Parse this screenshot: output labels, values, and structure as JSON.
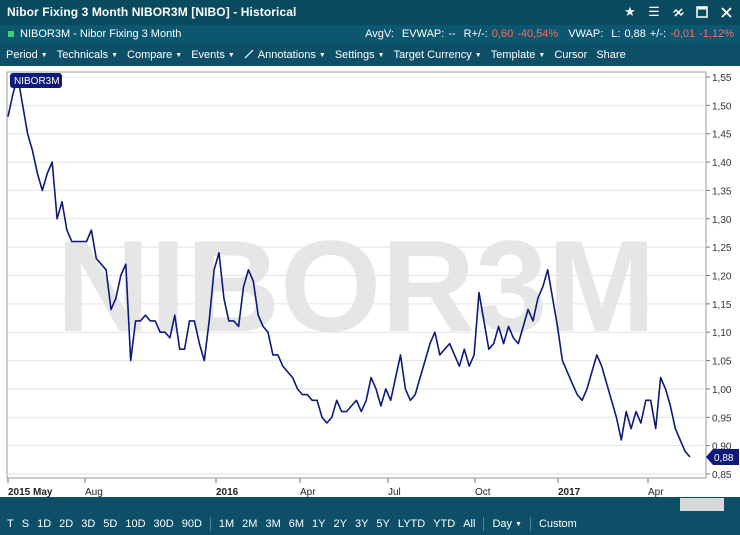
{
  "window": {
    "title": "Nibor Fixing 3 Month NIBOR3M [NIBO] - Historical",
    "icons": [
      "star-icon",
      "menu-icon",
      "unlink-icon",
      "minimize-icon",
      "close-icon"
    ]
  },
  "infobar": {
    "name": "NIBOR3M - Nibor Fixing 3 Month",
    "avgv_label": "AvgV:",
    "evwap_label": "EVWAP:",
    "evwap_value": "--",
    "change_label": "R+/-:",
    "change_value": "0,60",
    "change_pct": "-40,54%",
    "vwap_label": "VWAP:",
    "last_label": "L:",
    "last_value": "0,88",
    "day_change_label": "+/-:",
    "day_change_value": "-0,01",
    "day_change_pct": "-1,12%"
  },
  "menu": [
    {
      "label": "Period",
      "caret": true
    },
    {
      "label": "Technicals",
      "caret": true
    },
    {
      "label": "Compare",
      "caret": true
    },
    {
      "label": "Events",
      "caret": true
    },
    {
      "label": "Annotations",
      "caret": true
    },
    {
      "label": "Settings",
      "caret": true
    },
    {
      "label": "Target Currency",
      "caret": true
    },
    {
      "label": "Template",
      "caret": true
    },
    {
      "label": "Cursor",
      "caret": false
    },
    {
      "label": "Share",
      "caret": false
    }
  ],
  "chart_data": {
    "type": "line",
    "series_label": "NIBOR3M",
    "watermark": "NIBOR3M",
    "last_value_label": "0,88",
    "ylim": [
      0.85,
      1.56
    ],
    "yticks": [
      "1,55",
      "1,50",
      "1,45",
      "1,40",
      "1,35",
      "1,30",
      "1,25",
      "1,20",
      "1,15",
      "1,10",
      "1,05",
      "1,00",
      "0,95",
      "0,90",
      "0,85"
    ],
    "xticks": [
      {
        "label": "2015 May",
        "bold": true
      },
      {
        "label": "Aug",
        "bold": false
      },
      {
        "label": "2016",
        "bold": true
      },
      {
        "label": "Apr",
        "bold": false
      },
      {
        "label": "Jul",
        "bold": false
      },
      {
        "label": "Oct",
        "bold": false
      },
      {
        "label": "2017",
        "bold": true
      },
      {
        "label": "Apr",
        "bold": false
      }
    ],
    "values": [
      1.48,
      1.52,
      1.55,
      1.5,
      1.45,
      1.42,
      1.38,
      1.35,
      1.38,
      1.4,
      1.3,
      1.33,
      1.28,
      1.26,
      1.26,
      1.26,
      1.26,
      1.28,
      1.23,
      1.22,
      1.21,
      1.14,
      1.16,
      1.2,
      1.22,
      1.05,
      1.12,
      1.12,
      1.13,
      1.12,
      1.12,
      1.1,
      1.1,
      1.09,
      1.13,
      1.07,
      1.07,
      1.12,
      1.12,
      1.08,
      1.05,
      1.12,
      1.21,
      1.24,
      1.16,
      1.12,
      1.12,
      1.11,
      1.18,
      1.21,
      1.19,
      1.13,
      1.11,
      1.1,
      1.06,
      1.06,
      1.04,
      1.03,
      1.02,
      1.0,
      0.99,
      0.99,
      0.98,
      0.98,
      0.95,
      0.94,
      0.95,
      0.98,
      0.96,
      0.96,
      0.97,
      0.98,
      0.96,
      0.98,
      1.02,
      1.0,
      0.97,
      1.0,
      0.98,
      1.02,
      1.06,
      1.0,
      0.98,
      0.99,
      1.02,
      1.05,
      1.08,
      1.1,
      1.06,
      1.07,
      1.08,
      1.06,
      1.04,
      1.07,
      1.04,
      1.06,
      1.17,
      1.12,
      1.07,
      1.08,
      1.11,
      1.08,
      1.11,
      1.09,
      1.08,
      1.11,
      1.14,
      1.12,
      1.16,
      1.18,
      1.21,
      1.16,
      1.11,
      1.05,
      1.03,
      1.01,
      0.99,
      0.98,
      1.0,
      1.03,
      1.06,
      1.04,
      1.01,
      0.98,
      0.95,
      0.91,
      0.96,
      0.93,
      0.96,
      0.94,
      0.98,
      0.98,
      0.93,
      1.02,
      1.0,
      0.97,
      0.93,
      0.91,
      0.89,
      0.88
    ]
  },
  "periods": [
    "T",
    "S",
    "1D",
    "2D",
    "3D",
    "5D",
    "10D",
    "30D",
    "90D",
    "1M",
    "2M",
    "3M",
    "6M",
    "1Y",
    "2Y",
    "3Y",
    "5Y",
    "LYTD",
    "YTD",
    "All"
  ],
  "interval": {
    "label": "Day",
    "caret": true
  },
  "custom_label": "Custom"
}
